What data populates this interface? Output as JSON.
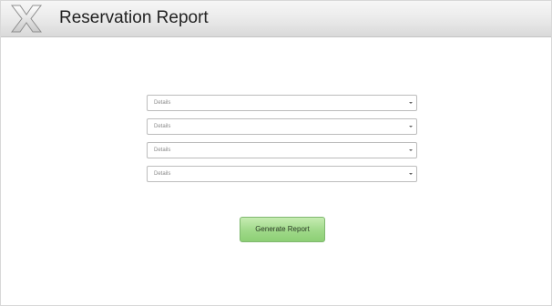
{
  "header": {
    "title": "Reservation Report",
    "logo_icon": "x-logo-icon"
  },
  "form": {
    "selects": [
      {
        "placeholder": "Details"
      },
      {
        "placeholder": "Details"
      },
      {
        "placeholder": "Details"
      },
      {
        "placeholder": "Details"
      }
    ],
    "generate_label": "Generate Report"
  },
  "colors": {
    "header_bg": "#e6e6e6",
    "button_green": "#9fd989",
    "placeholder_text": "#8a8a8a"
  }
}
